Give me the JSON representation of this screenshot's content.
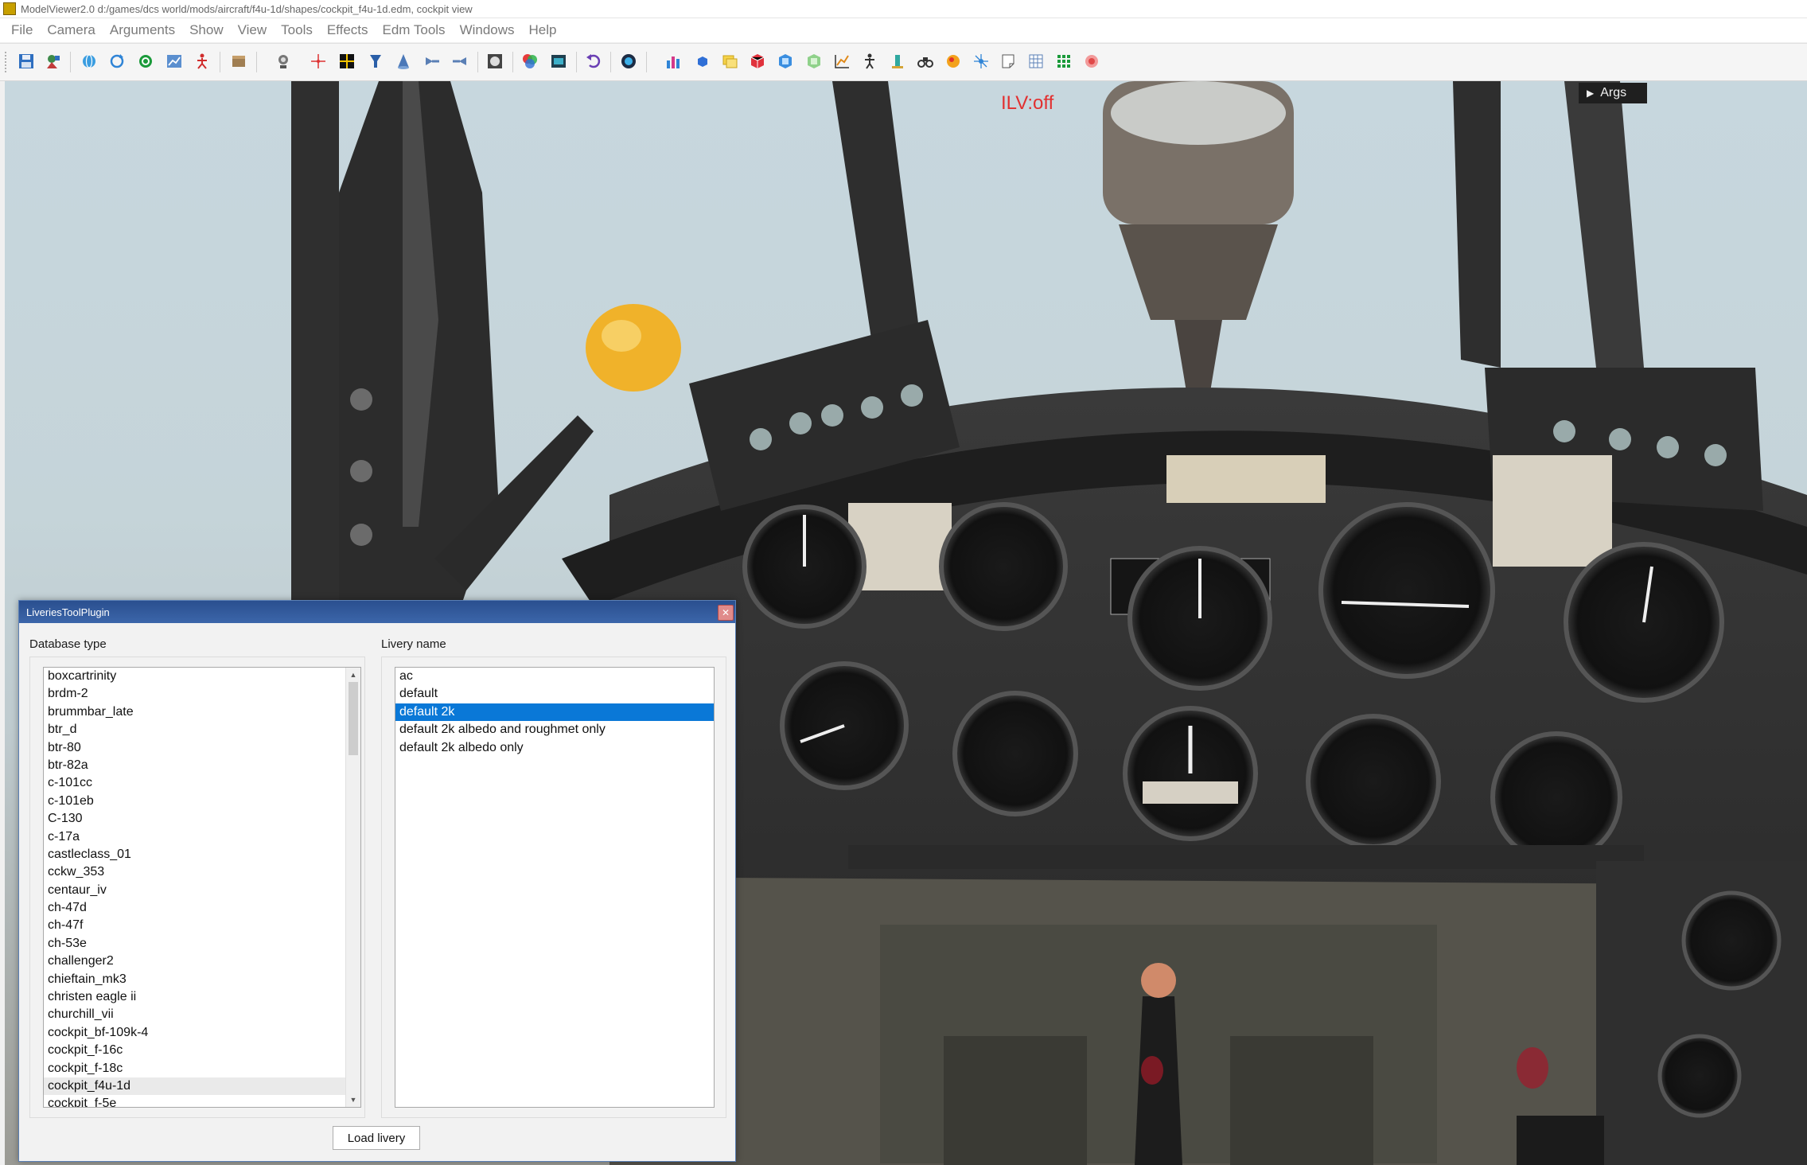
{
  "window": {
    "title": "ModelViewer2.0 d:/games/dcs world/mods/aircraft/f4u-1d/shapes/cockpit_f4u-1d.edm, cockpit view"
  },
  "menu": [
    {
      "label": "File"
    },
    {
      "label": "Camera"
    },
    {
      "label": "Arguments"
    },
    {
      "label": "Show"
    },
    {
      "label": "View"
    },
    {
      "label": "Tools"
    },
    {
      "label": "Effects"
    },
    {
      "label": "Edm Tools"
    },
    {
      "label": "Windows"
    },
    {
      "label": "Help"
    }
  ],
  "toolbar": {
    "icons": [
      "save-icon",
      "open-model-icon",
      "globe-icon",
      "refresh-icon",
      "reload-icon",
      "chart-icon",
      "skeleton-icon",
      "box-icon",
      "camera-icon",
      "crosshair-icon",
      "grid-icon",
      "lamp-icon",
      "cone-icon",
      "arrow-right-icon",
      "arrow-left-icon",
      "texture-icon",
      "color-icon",
      "film-icon",
      "undo-icon",
      "compass-icon",
      "bar-chart-icon",
      "cube-small-icon",
      "folder-icon",
      "red-cube-icon",
      "blue-cube-icon",
      "green-cube-icon",
      "graph-icon",
      "figure-icon",
      "tower-icon",
      "binoculars-icon",
      "circle-icon",
      "node-icon",
      "note-icon",
      "grid2-icon",
      "grid3-icon",
      "target-icon"
    ]
  },
  "viewport": {
    "ilv_status": "ILV:off",
    "args_button": "Args"
  },
  "dialog": {
    "title": "LiveriesToolPlugin",
    "database_label": "Database type",
    "livery_label": "Livery name",
    "database_items": [
      "boxcartrinity",
      "brdm-2",
      "brummbar_late",
      "btr_d",
      "btr-80",
      "btr-82a",
      "c-101cc",
      "c-101eb",
      "C-130",
      "c-17a",
      "castleclass_01",
      "cckw_353",
      "centaur_iv",
      "ch-47d",
      "ch-47f",
      "ch-53e",
      "challenger2",
      "chieftain_mk3",
      "christen eagle ii",
      "churchill_vii",
      "cockpit_bf-109k-4",
      "cockpit_f-16c",
      "cockpit_f-18c",
      "cockpit_f4u-1d",
      "cockpit_f-5e"
    ],
    "database_current": "cockpit_f4u-1d",
    "livery_items": [
      "ac",
      "default",
      "default 2k",
      "default 2k albedo and roughmet only",
      "default 2k albedo only"
    ],
    "livery_selected": "default 2k",
    "load_button": "Load livery"
  },
  "colors": {
    "accent_selection": "#0a78d7",
    "dialog_titlebar": "#2a4f8f",
    "ilv_text": "#e23030"
  }
}
